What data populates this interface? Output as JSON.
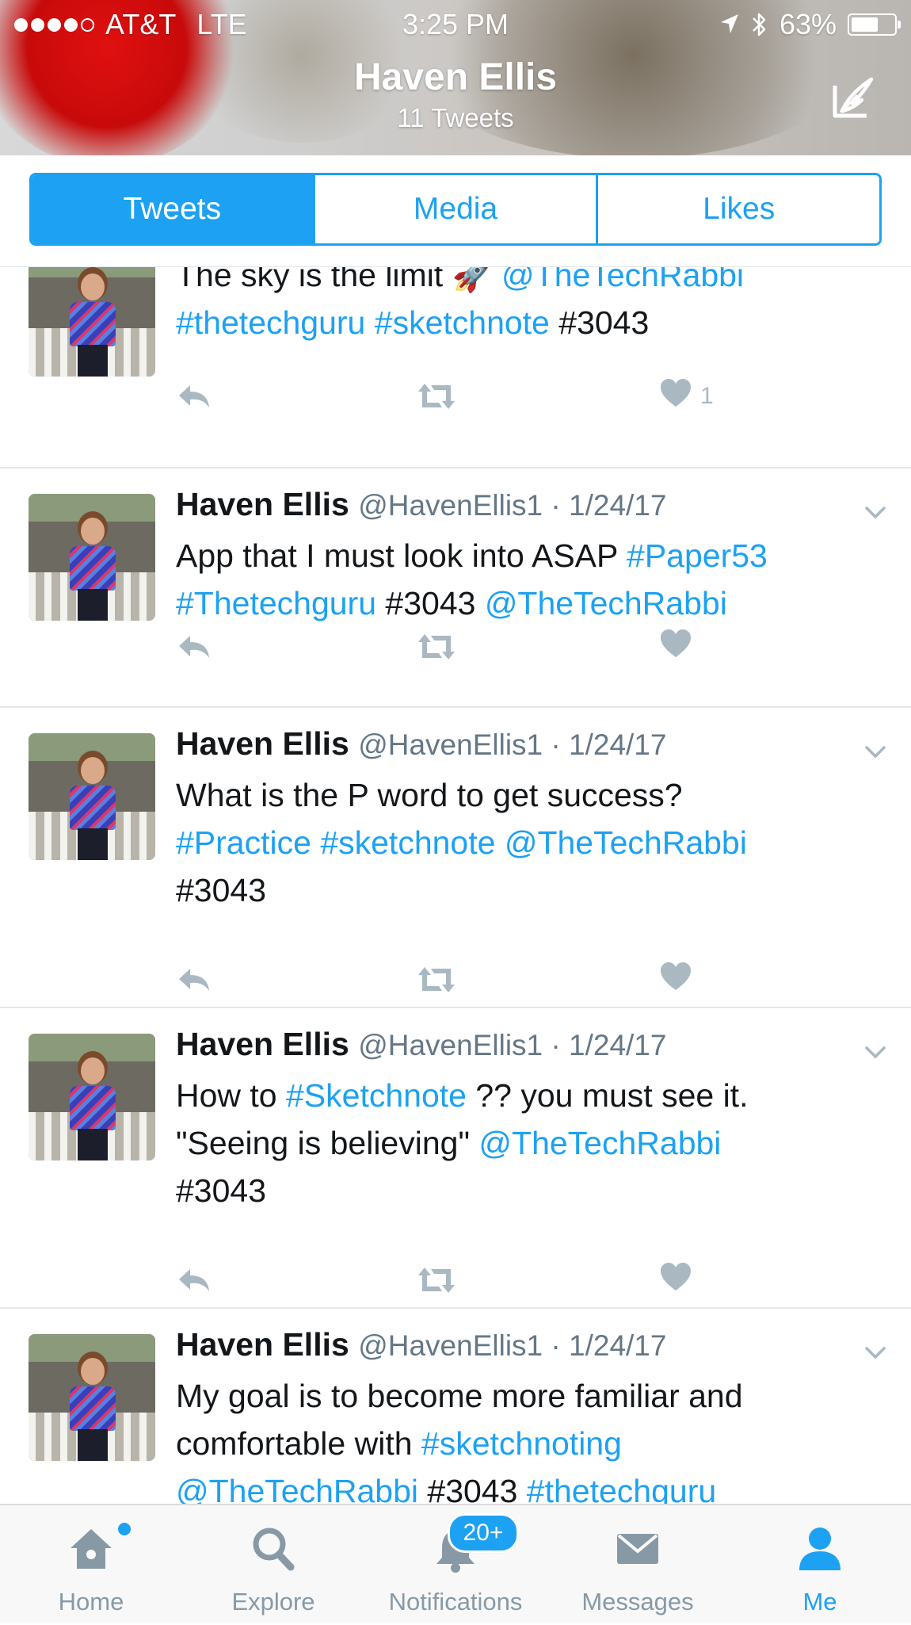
{
  "status_bar": {
    "carrier": "AT&T",
    "network": "LTE",
    "time": "3:25 PM",
    "battery": "63%",
    "battery_level": 0.63
  },
  "header": {
    "name": "Haven Ellis",
    "tweet_count": "11 Tweets",
    "compose_icon": "compose-icon"
  },
  "tabs": [
    {
      "label": "Tweets",
      "active": true
    },
    {
      "label": "Media",
      "active": false
    },
    {
      "label": "Likes",
      "active": false
    }
  ],
  "tweets": [
    {
      "partial": true,
      "segments_l1": [
        {
          "t": "The sky is the limit ",
          "link": false
        },
        {
          "t": "🚀 ",
          "link": false
        },
        {
          "t": "@TheTechRabbi",
          "link": true
        }
      ],
      "segments_l2": [
        {
          "t": "#thetechguru",
          "link": true
        },
        {
          "t": " ",
          "link": false
        },
        {
          "t": "#sketchnote",
          "link": true
        },
        {
          "t": " #3043",
          "link": false
        }
      ],
      "like_count": "1"
    },
    {
      "name": "Haven Ellis",
      "handle": "@HavenEllis1",
      "date": "1/24/17",
      "lines": [
        [
          {
            "t": "App that I must look into ASAP ",
            "link": false
          },
          {
            "t": "#Paper53",
            "link": true
          }
        ],
        [
          {
            "t": "#Thetechguru",
            "link": true
          },
          {
            "t": " #3043 ",
            "link": false
          },
          {
            "t": "@TheTechRabbi",
            "link": true
          }
        ]
      ],
      "like_count": ""
    },
    {
      "name": "Haven Ellis",
      "handle": "@HavenEllis1",
      "date": "1/24/17",
      "lines": [
        [
          {
            "t": "What is the P word to get success?",
            "link": false
          }
        ],
        [
          {
            "t": "#Practice",
            "link": true
          },
          {
            "t": " ",
            "link": false
          },
          {
            "t": "#sketchnote",
            "link": true
          },
          {
            "t": " ",
            "link": false
          },
          {
            "t": "@TheTechRabbi",
            "link": true
          }
        ],
        [
          {
            "t": "#3043",
            "link": false
          }
        ]
      ],
      "like_count": ""
    },
    {
      "name": "Haven Ellis",
      "handle": "@HavenEllis1",
      "date": "1/24/17",
      "lines": [
        [
          {
            "t": "How to ",
            "link": false
          },
          {
            "t": "#Sketchnote",
            "link": true
          },
          {
            "t": " ?? you must see it.",
            "link": false
          }
        ],
        [
          {
            "t": "\"Seeing is believing\" ",
            "link": false
          },
          {
            "t": "@TheTechRabbi",
            "link": true
          }
        ],
        [
          {
            "t": "#3043",
            "link": false
          }
        ]
      ],
      "like_count": ""
    },
    {
      "name": "Haven Ellis",
      "handle": "@HavenEllis1",
      "date": "1/24/17",
      "lines": [
        [
          {
            "t": "My goal is to become more familiar and",
            "link": false
          }
        ],
        [
          {
            "t": "comfortable with ",
            "link": false
          },
          {
            "t": "#sketchnoting",
            "link": true
          }
        ],
        [
          {
            "t": "@TheTechRabbi",
            "link": true
          },
          {
            "t": " #3043 ",
            "link": false
          },
          {
            "t": "#thetechguru",
            "link": true
          }
        ]
      ],
      "like_count": ""
    }
  ],
  "tab_bar": {
    "items": [
      {
        "label": "Home",
        "icon": "home-icon",
        "active": false
      },
      {
        "label": "Explore",
        "icon": "search-icon",
        "active": false
      },
      {
        "label": "Notifications",
        "icon": "bell-icon",
        "active": false
      },
      {
        "label": "Messages",
        "icon": "envelope-icon",
        "active": false
      },
      {
        "label": "Me",
        "icon": "person-icon",
        "active": true
      }
    ],
    "notifications_badge": "20+"
  },
  "colors": {
    "accent": "#1da1f2",
    "text": "#14171a",
    "muted": "#657786",
    "action_gray": "#aab8c2"
  }
}
